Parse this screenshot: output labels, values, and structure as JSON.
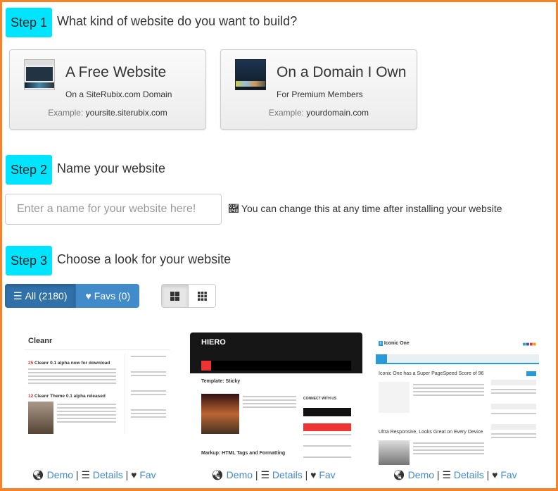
{
  "step1": {
    "badge": "Step 1",
    "question": "What kind of website do you want to build?",
    "options": [
      {
        "title": "A Free Website",
        "subtitle": "On a SiteRubix.com Domain",
        "example_label": "Example:",
        "example_value": "yoursite.siterubix.com"
      },
      {
        "title": "On a Domain I Own",
        "subtitle": "For Premium Members",
        "example_label": "Example:",
        "example_value": "yourdomain.com"
      }
    ]
  },
  "step2": {
    "badge": "Step 2",
    "question": "Name your website",
    "placeholder": "Enter a name for your website here!",
    "value": "",
    "hint": "You can change this at any time after installing your website"
  },
  "step3": {
    "badge": "Step 3",
    "question": "Choose a look for your website",
    "filters": [
      {
        "label": "All (2180)",
        "icon": "list-icon",
        "active": true
      },
      {
        "label": "Favs (0)",
        "icon": "heart-icon",
        "active": false
      }
    ],
    "view_toggle": [
      {
        "icon": "large-grid-icon",
        "active": true
      },
      {
        "icon": "small-grid-icon",
        "active": false
      }
    ],
    "themes": [
      {
        "name": "Cleanr",
        "posts": [
          "Cleanr 0.1 alpha now for download",
          "Cleanr Theme 0.1 alpha released"
        ]
      },
      {
        "name": "HIERO",
        "posts": [
          "Template: Sticky",
          "Markup: HTML Tags and Formatting"
        ],
        "sidebar_title": "CONNECT WITH US"
      },
      {
        "name": "Iconic One",
        "posts": [
          "Iconic One has a Super PageSpeed Score of 96",
          "Ultra Responsive, Looks Great on Every Device"
        ]
      }
    ],
    "actions": {
      "demo": "Demo",
      "details": "Details",
      "fav": "Fav",
      "separator": "|"
    }
  },
  "colors": {
    "accent": "#f5832a",
    "badge": "#00e5ff",
    "primary": "#428bca"
  }
}
